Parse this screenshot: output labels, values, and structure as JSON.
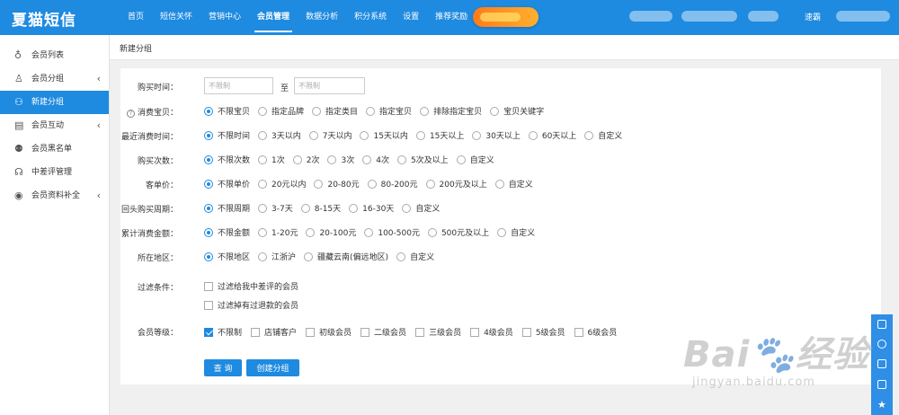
{
  "app": {
    "logo": "夏猫短信",
    "user_name": "速霸"
  },
  "nav": [
    "首页",
    "短信关怀",
    "营销中心",
    "会员管理",
    "数据分析",
    "积分系统",
    "设置",
    "推荐奖励"
  ],
  "nav_active": "会员管理",
  "sidebar": [
    {
      "label": "会员列表",
      "icon": "members-icon",
      "chevron": false,
      "active": false
    },
    {
      "label": "会员分组",
      "icon": "user-icon",
      "chevron": true,
      "active": false
    },
    {
      "label": "新建分组",
      "icon": "add-user-icon",
      "chevron": false,
      "active": true
    },
    {
      "label": "会员互动",
      "icon": "interaction-icon",
      "chevron": true,
      "active": false
    },
    {
      "label": "会员黑名单",
      "icon": "blacklist-icon",
      "chevron": false,
      "active": false
    },
    {
      "label": "中差评管理",
      "icon": "review-icon",
      "chevron": false,
      "active": false
    },
    {
      "label": "会员资料补全",
      "icon": "profile-icon",
      "chevron": true,
      "active": false
    }
  ],
  "page_title": "新建分组",
  "purchase_time": {
    "label": "购买时间：",
    "from_placeholder": "不限制",
    "to_label": "至",
    "to_placeholder": "不限制"
  },
  "radio_rows": [
    {
      "key": "shop_item",
      "label": "消费宝贝：",
      "help": true,
      "selected": 0,
      "options": [
        "不限宝贝",
        "指定品牌",
        "指定类目",
        "指定宝贝",
        "排除指定宝贝",
        "宝贝关键字"
      ]
    },
    {
      "key": "recent",
      "label": "最近消费时间：",
      "selected": 0,
      "options": [
        "不限时间",
        "3天以内",
        "7天以内",
        "15天以内",
        "15天以上",
        "30天以上",
        "60天以上",
        "自定义"
      ]
    },
    {
      "key": "count",
      "label": "购买次数：",
      "selected": 0,
      "options": [
        "不限次数",
        "1次",
        "2次",
        "3次",
        "4次",
        "5次及以上",
        "自定义"
      ]
    },
    {
      "key": "unit_price",
      "label": "客单价：",
      "selected": 0,
      "options": [
        "不限单价",
        "20元以内",
        "20-80元",
        "80-200元",
        "200元及以上",
        "自定义"
      ]
    },
    {
      "key": "cycle",
      "label": "回头购买周期：",
      "selected": 0,
      "options": [
        "不限周期",
        "3-7天",
        "8-15天",
        "16-30天",
        "自定义"
      ]
    },
    {
      "key": "total",
      "label": "累计消费金额：",
      "selected": 0,
      "options": [
        "不限金额",
        "1-20元",
        "20-100元",
        "100-500元",
        "500元及以上",
        "自定义"
      ]
    },
    {
      "key": "region",
      "label": "所在地区：",
      "selected": 0,
      "options": [
        "不限地区",
        "江浙沪",
        "疆藏云南(偏远地区)",
        "自定义"
      ]
    }
  ],
  "filter": {
    "label": "过滤条件：",
    "options": [
      "过滤给我中差评的会员",
      "过滤掉有过退款的会员"
    ]
  },
  "level": {
    "label": "会员等级：",
    "checked": 0,
    "options": [
      "不限制",
      "店铺客户",
      "初级会员",
      "二级会员",
      "三级会员",
      "4级会员",
      "5级会员",
      "6级会员"
    ]
  },
  "buttons": {
    "query": "查 询",
    "create": "创建分组"
  },
  "watermark": {
    "brand": "Bai",
    "brand_cn": "经验",
    "url": "jingyan.baidu.com"
  }
}
